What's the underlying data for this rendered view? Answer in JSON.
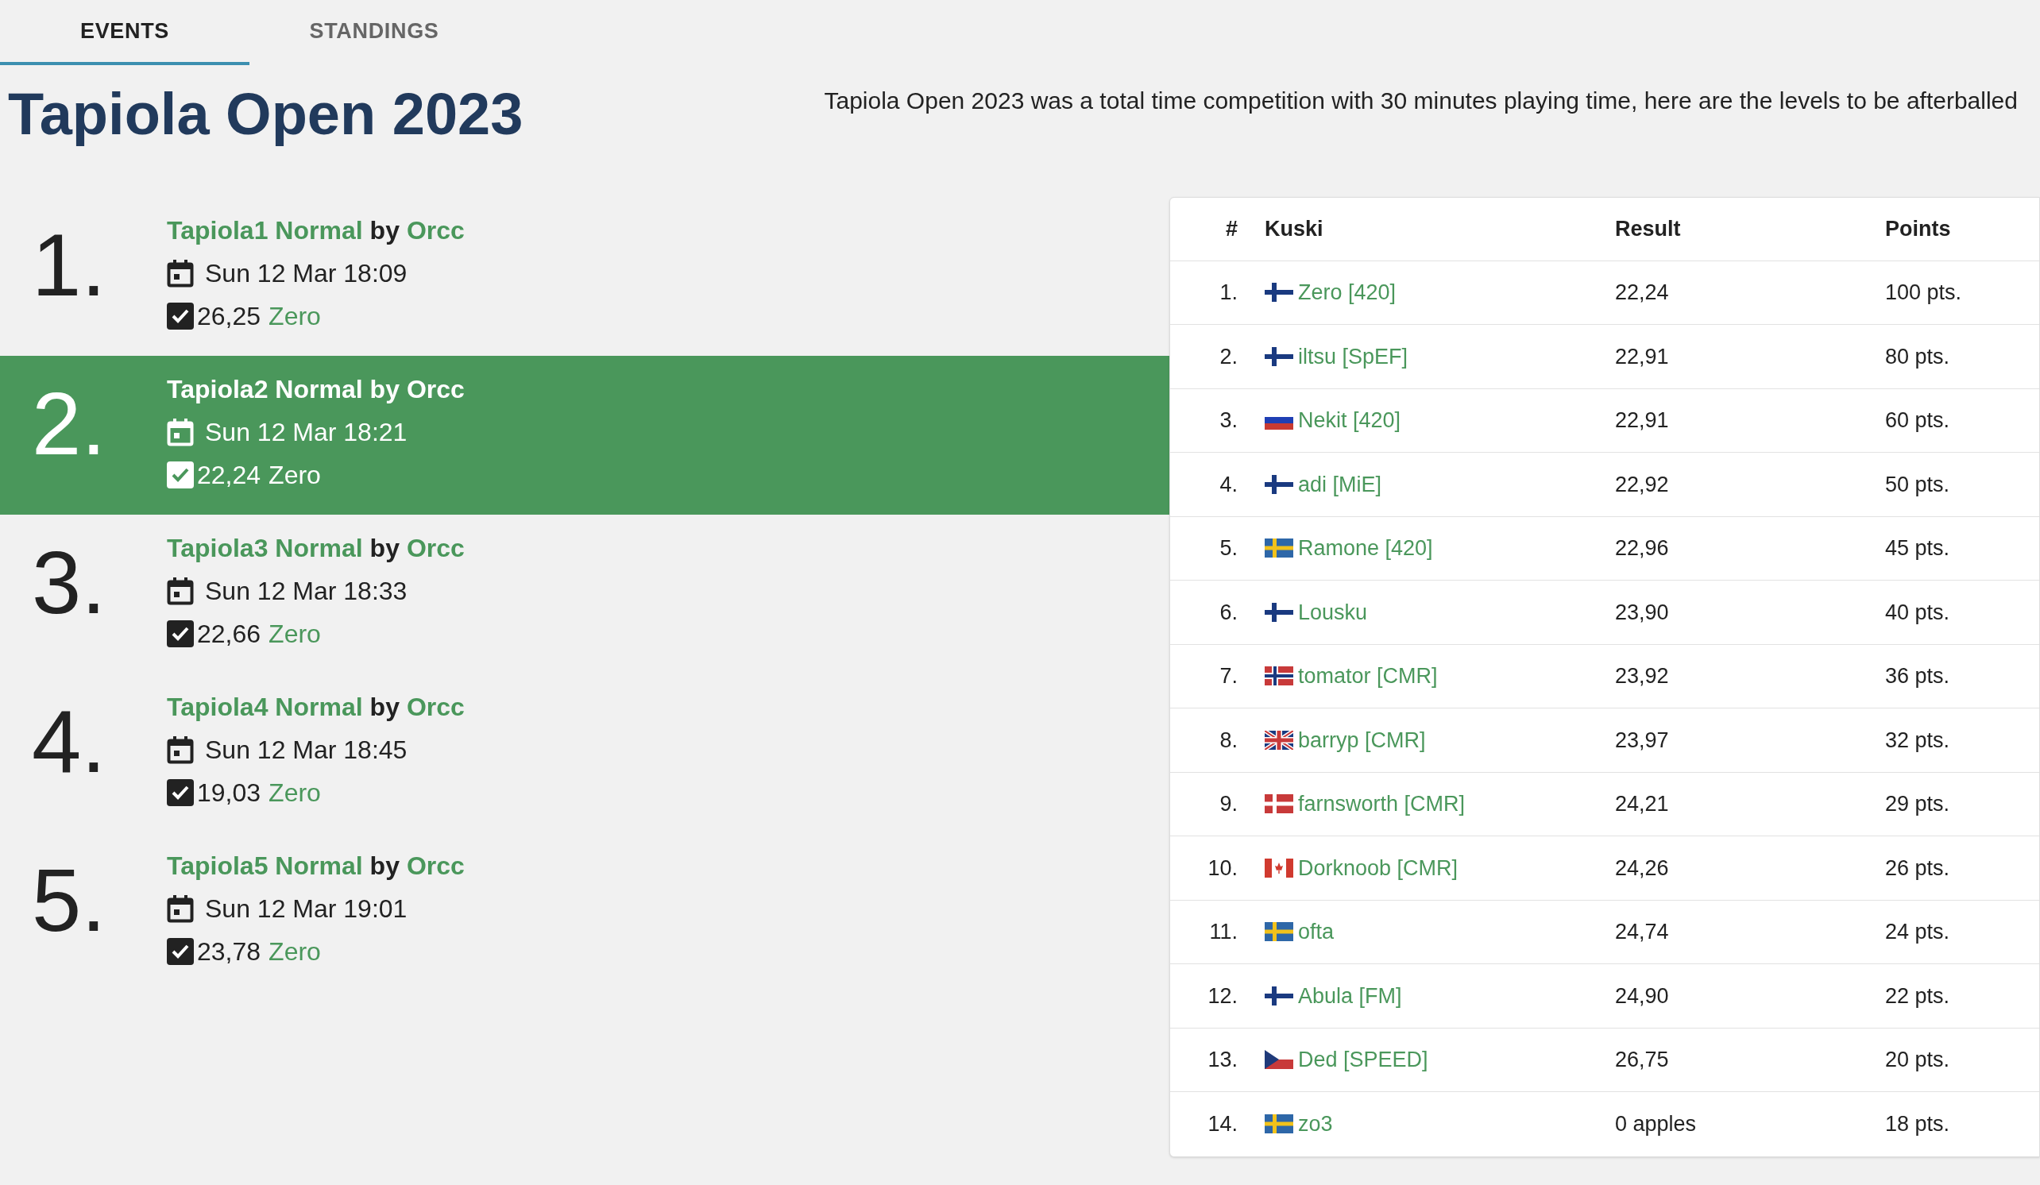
{
  "tabs": [
    {
      "label": "EVENTS",
      "selected": true
    },
    {
      "label": "STANDINGS",
      "selected": false
    }
  ],
  "title": "Tapiola Open 2023",
  "description": "Tapiola Open 2023 was a total time competition with 30 minutes playing time, here are the levels to be afterballed",
  "events": [
    {
      "number": "1.",
      "level": "Tapiola1 Normal",
      "by": "by",
      "author": "Orcc",
      "date": "Sun 12 Mar 18:09",
      "time": "26,25",
      "winner": "Zero",
      "selected": false
    },
    {
      "number": "2.",
      "level": "Tapiola2 Normal",
      "by": "by",
      "author": "Orcc",
      "date": "Sun 12 Mar 18:21",
      "time": "22,24",
      "winner": "Zero",
      "selected": true
    },
    {
      "number": "3.",
      "level": "Tapiola3 Normal",
      "by": "by",
      "author": "Orcc",
      "date": "Sun 12 Mar 18:33",
      "time": "22,66",
      "winner": "Zero",
      "selected": false
    },
    {
      "number": "4.",
      "level": "Tapiola4 Normal",
      "by": "by",
      "author": "Orcc",
      "date": "Sun 12 Mar 18:45",
      "time": "19,03",
      "winner": "Zero",
      "selected": false
    },
    {
      "number": "5.",
      "level": "Tapiola5 Normal",
      "by": "by",
      "author": "Orcc",
      "date": "Sun 12 Mar 19:01",
      "time": "23,78",
      "winner": "Zero",
      "selected": false
    }
  ],
  "table": {
    "columns": [
      "#",
      "Kuski",
      "Result",
      "Points"
    ],
    "rows": [
      {
        "rank": "1.",
        "kind": "fi",
        "kuski": "Zero [420]",
        "result": "22,24",
        "points": "100 pts."
      },
      {
        "rank": "2.",
        "kind": "fi",
        "kuski": "iltsu [SpEF]",
        "result": "22,91",
        "points": "80 pts."
      },
      {
        "rank": "3.",
        "kind": "ru",
        "kuski": "Nekit [420]",
        "result": "22,91",
        "points": "60 pts."
      },
      {
        "rank": "4.",
        "kind": "fi",
        "kuski": "adi [MiE]",
        "result": "22,92",
        "points": "50 pts."
      },
      {
        "rank": "5.",
        "kind": "se",
        "kuski": "Ramone [420]",
        "result": "22,96",
        "points": "45 pts."
      },
      {
        "rank": "6.",
        "kind": "fi",
        "kuski": "Lousku",
        "result": "23,90",
        "points": "40 pts."
      },
      {
        "rank": "7.",
        "kind": "no",
        "kuski": "tomator [CMR]",
        "result": "23,92",
        "points": "36 pts."
      },
      {
        "rank": "8.",
        "kind": "gb",
        "kuski": "barryp [CMR]",
        "result": "23,97",
        "points": "32 pts."
      },
      {
        "rank": "9.",
        "kind": "dk",
        "kuski": "farnsworth [CMR]",
        "result": "24,21",
        "points": "29 pts."
      },
      {
        "rank": "10.",
        "kind": "ca",
        "kuski": "Dorknoob [CMR]",
        "result": "24,26",
        "points": "26 pts."
      },
      {
        "rank": "11.",
        "kind": "se",
        "kuski": "ofta",
        "result": "24,74",
        "points": "24 pts."
      },
      {
        "rank": "12.",
        "kind": "fi",
        "kuski": "Abula [FM]",
        "result": "24,90",
        "points": "22 pts."
      },
      {
        "rank": "13.",
        "kind": "cz",
        "kuski": "Ded [SPEED]",
        "result": "26,75",
        "points": "20 pts."
      },
      {
        "rank": "14.",
        "kind": "se",
        "kuski": "zo3",
        "result": "0 apples",
        "points": "18 pts."
      }
    ]
  }
}
